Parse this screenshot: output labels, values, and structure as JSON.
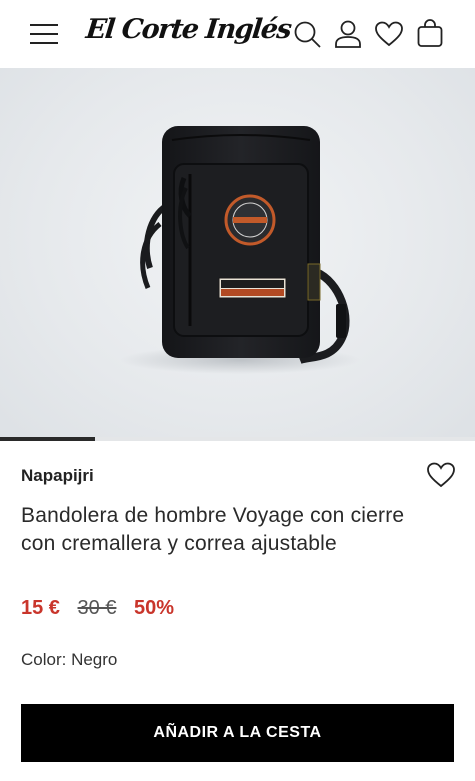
{
  "header": {
    "logo_text": "El Corte Inglés",
    "menu_icon": "hamburger-menu-icon",
    "icons": [
      "search-icon",
      "user-icon",
      "heart-icon",
      "bag-icon"
    ]
  },
  "product": {
    "image_alt": "bandolera-negra-napapijri",
    "carousel_progress": 0.2,
    "brand": "Napapijri",
    "title": "Bandolera de hombre Voyage con cierre con cremallera y correa ajustable",
    "price_current": "15 €",
    "price_original": "30 €",
    "discount": "50%",
    "color_label": "Color: Negro",
    "badge_logo_text": "NAPAPIJRI",
    "badge_label_text": "NAPAPIJRI",
    "badge_label_subtext": "geographic"
  },
  "cta": {
    "add_to_cart": "AÑADIR A LA CESTA"
  },
  "colors": {
    "price_accent": "#c9352b",
    "cta_bg": "#000000"
  }
}
